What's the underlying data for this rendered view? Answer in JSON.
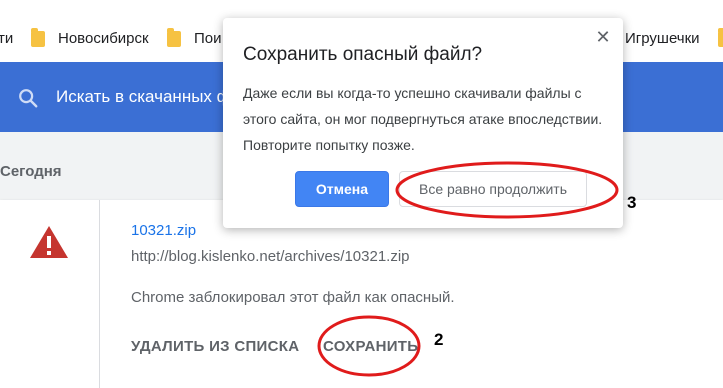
{
  "bookmarks": {
    "items": [
      "ти",
      "Новосибирск",
      "Пои",
      "Игрушечки"
    ]
  },
  "downloads": {
    "search_placeholder": "Искать в скачанных ф",
    "section_title": "Сегодня",
    "item": {
      "file_name": "10321.zip",
      "url": "http://blog.kislenko.net/archives/10321.zip",
      "warning": "Chrome заблокировал этот файл как опасный.",
      "remove_label": "УДАЛИТЬ ИЗ СПИСКА",
      "save_label": "СОХРАНИТЬ"
    }
  },
  "dialog": {
    "title": "Сохранить опасный файл?",
    "close_symbol": "✕",
    "body": "Даже если вы когда-то успешно скачивали файлы с этого сайта, он мог подвергнуться атаке впоследствии. Повторите попытку позже.",
    "cancel_label": "Отмена",
    "continue_label": "Все равно продолжить"
  },
  "annotations": {
    "step_save": "2",
    "step_continue": "3"
  },
  "colors": {
    "header": "#3b6fd4",
    "link": "#1a73e8",
    "warning_icon": "#c5352f",
    "primary_button": "#4285f4",
    "annotation_ellipse": "#e01b1b"
  },
  "icons": [
    "folder-icon",
    "search-icon",
    "warning-icon",
    "close-icon"
  ]
}
